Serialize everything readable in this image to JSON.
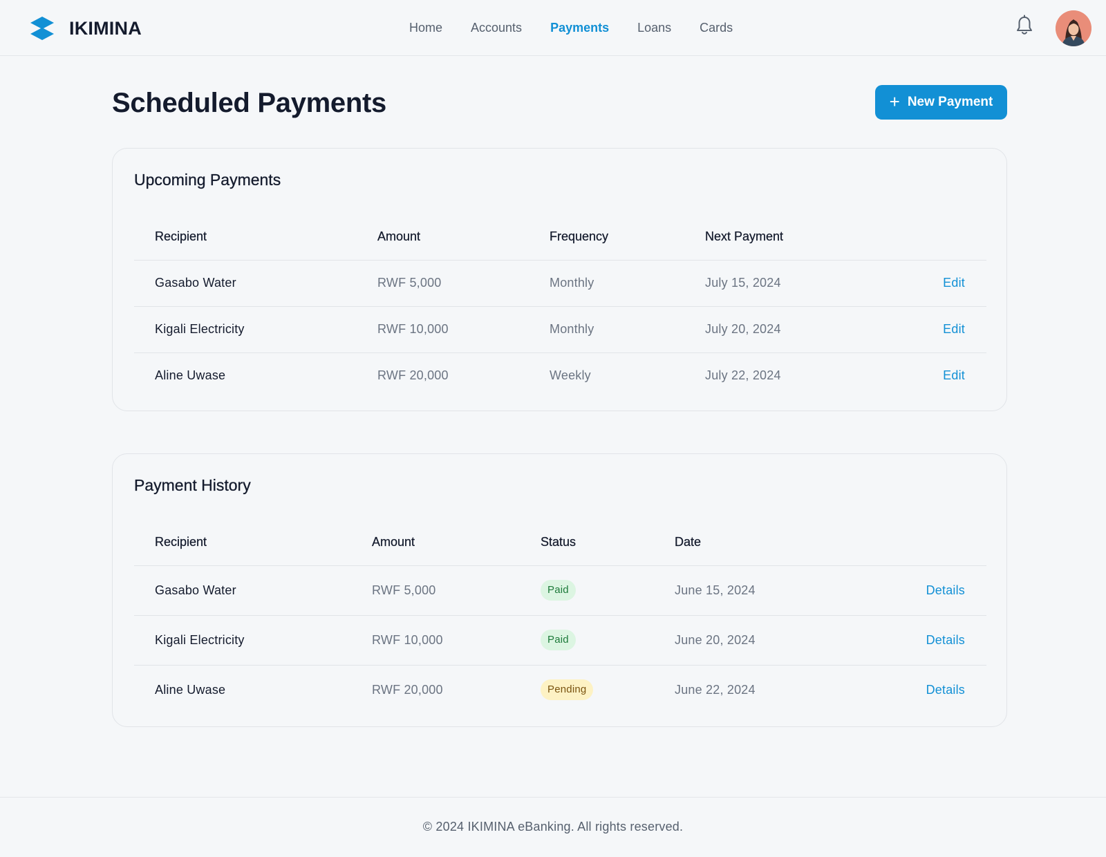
{
  "brand": {
    "name": "IKIMINA",
    "accent": "#1290d5"
  },
  "nav": {
    "items": [
      {
        "label": "Home",
        "active": false
      },
      {
        "label": "Accounts",
        "active": false
      },
      {
        "label": "Payments",
        "active": true
      },
      {
        "label": "Loans",
        "active": false
      },
      {
        "label": "Cards",
        "active": false
      }
    ]
  },
  "header": {
    "notification_icon": "bell-icon",
    "avatar_icon": "user-avatar"
  },
  "page": {
    "title": "Scheduled Payments",
    "new_payment_label": "New Payment",
    "new_payment_icon": "plus-icon"
  },
  "upcoming": {
    "title": "Upcoming Payments",
    "columns": [
      "Recipient",
      "Amount",
      "Frequency",
      "Next Payment"
    ],
    "rows": [
      {
        "recipient": "Gasabo Water",
        "amount": "RWF 5,000",
        "frequency": "Monthly",
        "next_payment": "July 15, 2024",
        "action": "Edit"
      },
      {
        "recipient": "Kigali Electricity",
        "amount": "RWF 10,000",
        "frequency": "Monthly",
        "next_payment": "July 20, 2024",
        "action": "Edit"
      },
      {
        "recipient": "Aline Uwase",
        "amount": "RWF 20,000",
        "frequency": "Weekly",
        "next_payment": "July 22, 2024",
        "action": "Edit"
      }
    ]
  },
  "history": {
    "title": "Payment History",
    "columns": [
      "Recipient",
      "Amount",
      "Status",
      "Date"
    ],
    "rows": [
      {
        "recipient": "Gasabo Water",
        "amount": "RWF 5,000",
        "status": "Paid",
        "date": "June 15, 2024",
        "action": "Details"
      },
      {
        "recipient": "Kigali Electricity",
        "amount": "RWF 10,000",
        "status": "Paid",
        "date": "June 20, 2024",
        "action": "Details"
      },
      {
        "recipient": "Aline Uwase",
        "amount": "RWF 20,000",
        "status": "Pending",
        "date": "June 22, 2024",
        "action": "Details"
      }
    ],
    "status_colors": {
      "Paid": {
        "bg": "#dcf5e2",
        "fg": "#1d7a3a"
      },
      "Pending": {
        "bg": "#fdf2c4",
        "fg": "#7a5410"
      }
    }
  },
  "footer": {
    "text": "© 2024 IKIMINA eBanking. All rights reserved."
  }
}
